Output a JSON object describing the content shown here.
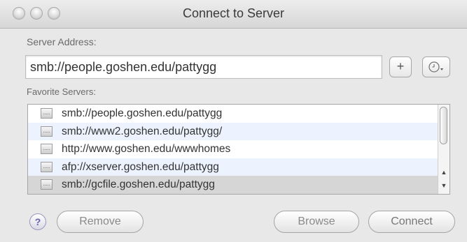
{
  "window": {
    "title": "Connect to Server"
  },
  "server_address": {
    "label": "Server Address:",
    "value": "smb://people.goshen.edu/pattygg",
    "add_glyph": "+",
    "recent_icon": "clock-icon"
  },
  "favorites": {
    "label": "Favorite Servers:",
    "items": [
      {
        "text": "smb://people.goshen.edu/pattygg"
      },
      {
        "text": "smb://www2.goshen.edu/pattygg/"
      },
      {
        "text": "http://www.goshen.edu/wwwhomes"
      },
      {
        "text": "afp://xserver.goshen.edu/pattygg"
      },
      {
        "text": "smb://gcfile.goshen.edu/pattygg"
      }
    ]
  },
  "buttons": {
    "help": "?",
    "remove": "Remove",
    "browse": "Browse",
    "connect": "Connect"
  }
}
